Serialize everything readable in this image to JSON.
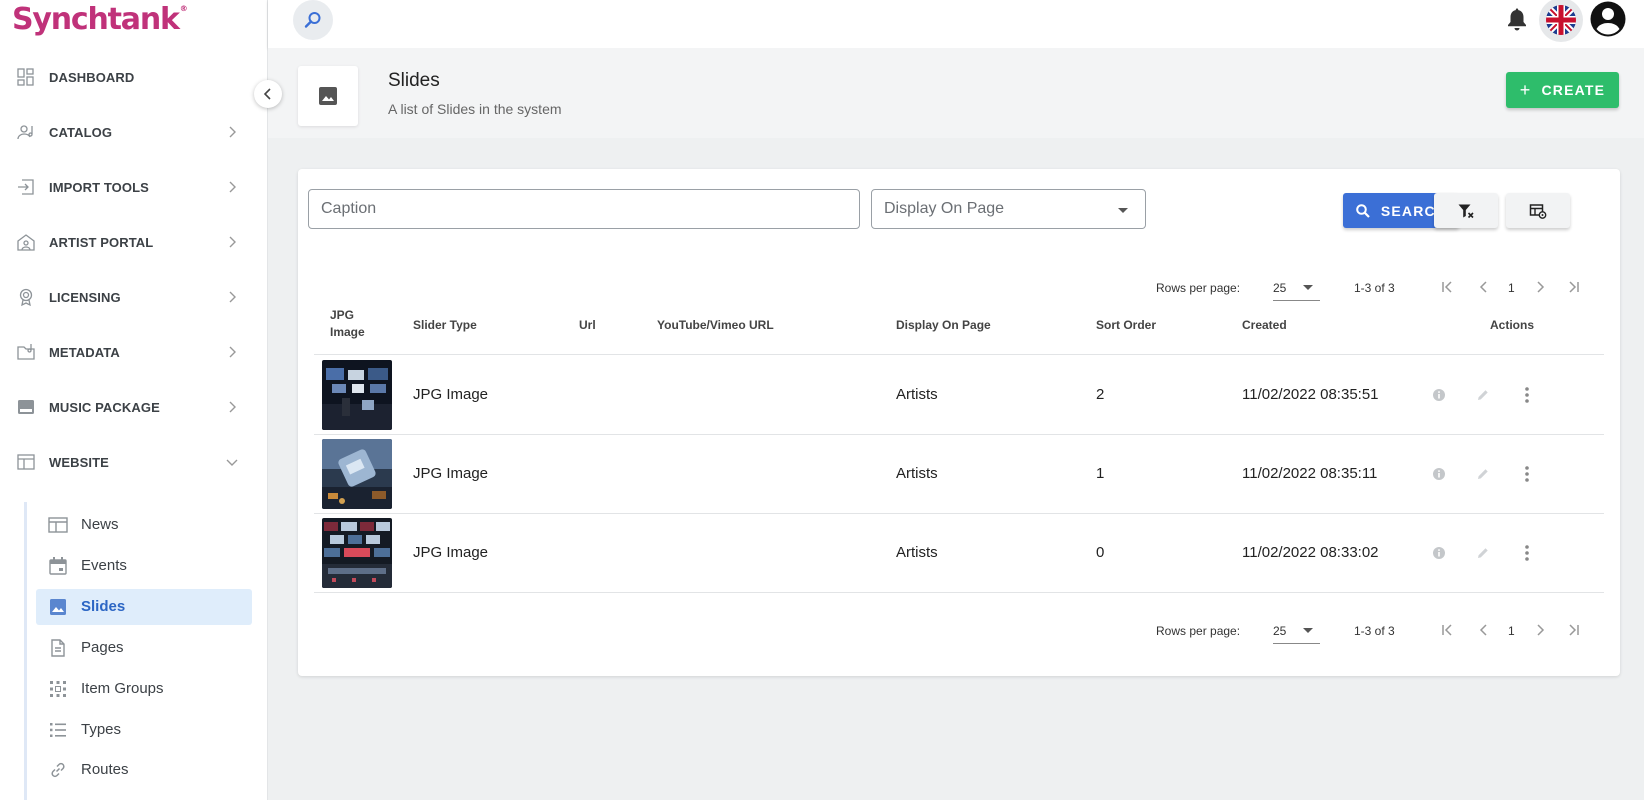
{
  "brand": {
    "logo_text": "Synchtank",
    "trademark": "®",
    "color": "#c0327a"
  },
  "sidebar": {
    "items": [
      {
        "label": "DASHBOARD",
        "icon": "dashboard-icon",
        "chevron": "none"
      },
      {
        "label": "CATALOG",
        "icon": "catalog-icon",
        "chevron": "right"
      },
      {
        "label": "IMPORT TOOLS",
        "icon": "import-icon",
        "chevron": "right"
      },
      {
        "label": "ARTIST PORTAL",
        "icon": "artist-portal-icon",
        "chevron": "right"
      },
      {
        "label": "LICENSING",
        "icon": "licensing-icon",
        "chevron": "right"
      },
      {
        "label": "METADATA",
        "icon": "metadata-icon",
        "chevron": "right"
      },
      {
        "label": "MUSIC PACKAGE",
        "icon": "music-package-icon",
        "chevron": "right"
      },
      {
        "label": "WEBSITE",
        "icon": "website-icon",
        "chevron": "down"
      }
    ],
    "subitems": [
      {
        "label": "News",
        "icon": "news-icon",
        "active": false
      },
      {
        "label": "Events",
        "icon": "calendar-icon",
        "active": false
      },
      {
        "label": "Slides",
        "icon": "image-icon",
        "active": true
      },
      {
        "label": "Pages",
        "icon": "page-icon",
        "active": false
      },
      {
        "label": "Item Groups",
        "icon": "grid-icon",
        "active": false
      },
      {
        "label": "Types",
        "icon": "list-icon",
        "active": false
      },
      {
        "label": "Routes",
        "icon": "link-icon",
        "active": false
      }
    ]
  },
  "topbar": {
    "search_icon": "search-icon",
    "bell_icon": "bell-icon",
    "language": "uk-flag-icon",
    "account_icon": "account-circle-icon"
  },
  "header": {
    "title": "Slides",
    "subtitle": "A list of Slides in the system",
    "create_label": "CREATE",
    "create_color": "#2ebd6b"
  },
  "filters": {
    "caption_placeholder": "Caption",
    "display_on_page_label": "Display On Page",
    "search_label": "SEARCH",
    "search_color": "#3b6fd6",
    "clear_filters_icon": "filter-clear-icon",
    "columns_icon": "table-settings-icon"
  },
  "pagination": {
    "rows_per_page_label": "Rows per page:",
    "rows_per_page": "25",
    "range": "1-3 of 3",
    "page": "1"
  },
  "table": {
    "columns": [
      "JPG Image",
      "Slider Type",
      "Url",
      "YouTube/Vimeo URL",
      "Display On Page",
      "Sort Order",
      "Created",
      "Actions"
    ],
    "rows": [
      {
        "image": "thumbnail-studio-1",
        "slider_type": "JPG Image",
        "url": "",
        "video_url": "",
        "display_on_page": "Artists",
        "sort_order": "2",
        "created": "11/02/2022 08:35:51"
      },
      {
        "image": "thumbnail-studio-2",
        "slider_type": "JPG Image",
        "url": "",
        "video_url": "",
        "display_on_page": "Artists",
        "sort_order": "1",
        "created": "11/02/2022 08:35:11"
      },
      {
        "image": "thumbnail-studio-3",
        "slider_type": "JPG Image",
        "url": "",
        "video_url": "",
        "display_on_page": "Artists",
        "sort_order": "0",
        "created": "11/02/2022 08:33:02"
      }
    ],
    "row_actions": [
      "info-icon",
      "edit-icon",
      "more-vert-icon"
    ]
  }
}
